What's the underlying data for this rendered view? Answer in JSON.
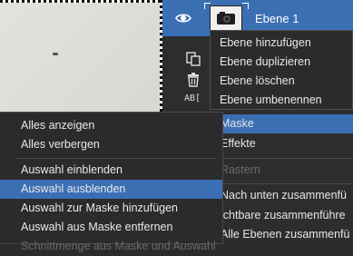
{
  "layers": {
    "name": "Ebene 1"
  },
  "layer_submenu": {
    "items": [
      "Ebene hinzufügen",
      "Ebene duplizieren",
      "Ebene löschen",
      "Ebene umbenennen"
    ]
  },
  "side_icons": {
    "rename_glyph": "AB["
  },
  "panel_menu": {
    "items": [
      {
        "label": "Maske",
        "state": "highlighted"
      },
      {
        "label": "Effekte",
        "state": "normal"
      },
      {
        "label": "Rastern",
        "state": "disabled"
      },
      {
        "label": "Nach unten zusammenfü",
        "state": "normal"
      },
      {
        "label": "ichtbare zusammenführe",
        "state": "normal"
      },
      {
        "label": "Alle Ebenen zusammenfü",
        "state": "normal"
      }
    ]
  },
  "mask_menu": {
    "items": [
      {
        "label": "Alles anzeigen",
        "state": "normal"
      },
      {
        "label": "Alles verbergen",
        "state": "normal"
      },
      {
        "label": "Auswahl einblenden",
        "state": "normal"
      },
      {
        "label": "Auswahl ausblenden",
        "state": "highlighted"
      },
      {
        "label": "Auswahl zur Maske hinzufügen",
        "state": "normal"
      },
      {
        "label": "Auswahl aus Maske entfernen",
        "state": "normal"
      },
      {
        "label": "Schnittmenge aus Maske und Auswahl",
        "state": "disabled"
      }
    ]
  },
  "colors": {
    "accent": "#3a6fb4",
    "menu_bg": "#2b2b2b",
    "text": "#e8e8e8",
    "disabled_text": "#6a6a6a"
  },
  "icons": [
    "eye-icon",
    "camera-thumbnail-icon",
    "duplicate-icon",
    "trash-icon",
    "rename-icon"
  ]
}
